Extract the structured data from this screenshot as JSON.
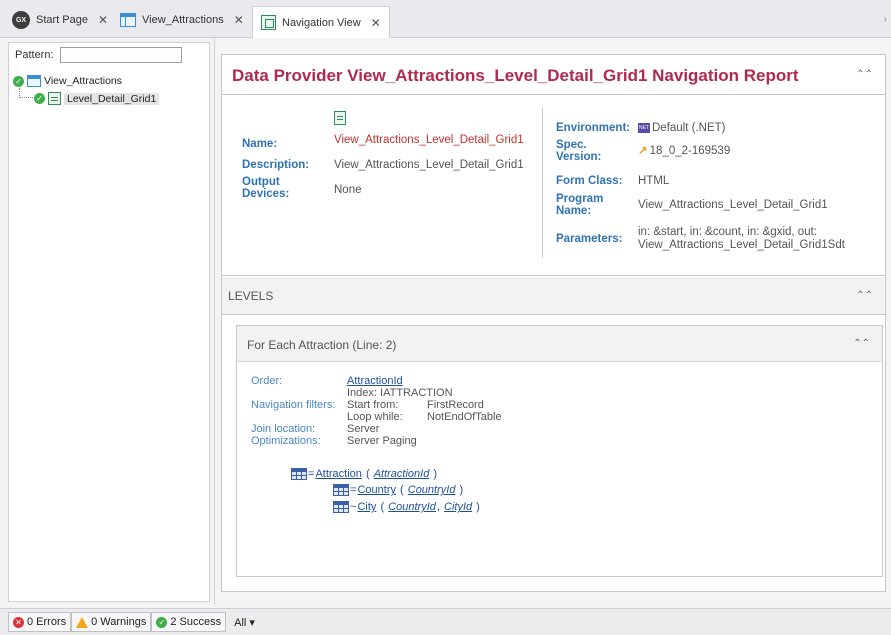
{
  "tabs": [
    {
      "label": "Start Page",
      "icon": "genexus-logo-icon"
    },
    {
      "label": "View_Attractions",
      "icon": "web-panel-icon"
    },
    {
      "label": "Navigation View",
      "icon": "navigation-view-icon"
    }
  ],
  "tab_close_glyph": "✕",
  "left_panel": {
    "pattern_label": "Pattern:",
    "pattern_value": "",
    "tree": [
      {
        "label": "View_Attractions",
        "status": "success"
      },
      {
        "label": "Level_Detail_Grid1",
        "status": "success",
        "selected": true
      }
    ]
  },
  "report": {
    "title": "Data Provider View_Attractions_Level_Detail_Grid1 Navigation Report",
    "name_label": "Name:",
    "name_value": "View_Attractions_Level_Detail_Grid1",
    "description_label": "Description:",
    "description_value": "View_Attractions_Level_Detail_Grid1",
    "output_devices_label": "Output Devices:",
    "output_devices_value": "None",
    "environment_label": "Environment:",
    "environment_badge": "NET",
    "environment_value": "Default (.NET)",
    "spec_version_label": "Spec. Version:",
    "spec_version_value": "18_0_2-169539",
    "form_class_label": "Form Class:",
    "form_class_value": "HTML",
    "program_name_label": "Program Name:",
    "program_name_value": "View_Attractions_Level_Detail_Grid1",
    "parameters_label": "Parameters:",
    "parameters_line1": "in: &start,  in: &count,  in: &gxid,  out:",
    "parameters_line2": "View_Attractions_Level_Detail_Grid1Sdt",
    "levels_label": "LEVELS",
    "for_each_title": "For Each Attraction (Line: 2)",
    "order_label": "Order:",
    "order_value": "AttractionId",
    "index_value": "Index: IATTRACTION",
    "nav_filters_label": "Navigation filters:",
    "start_from_label": "Start from:",
    "start_from_value": "FirstRecord",
    "loop_while_label": "Loop while:",
    "loop_while_value": "NotEndOfTable",
    "join_location_label": "Join location:",
    "join_location_value": "Server",
    "optimizations_label": "Optimizations:",
    "optimizations_value": "Server Paging",
    "tables": [
      {
        "prefix": "=",
        "table": "Attraction",
        "keys": [
          "AttractionId"
        ]
      },
      {
        "prefix": "=",
        "table": "Country",
        "keys": [
          "CountryId"
        ]
      },
      {
        "prefix": "~",
        "table": "City",
        "keys": [
          "CountryId",
          "CityId"
        ]
      }
    ]
  },
  "status": {
    "errors": "0 Errors",
    "warnings": "0 Warnings",
    "success": "2 Success",
    "filter": "All ▾"
  },
  "colors": {
    "title": "#b02a4e",
    "label_blue": "#2f73b4",
    "link": "#1d4f9c",
    "name_red": "#c0332e"
  }
}
